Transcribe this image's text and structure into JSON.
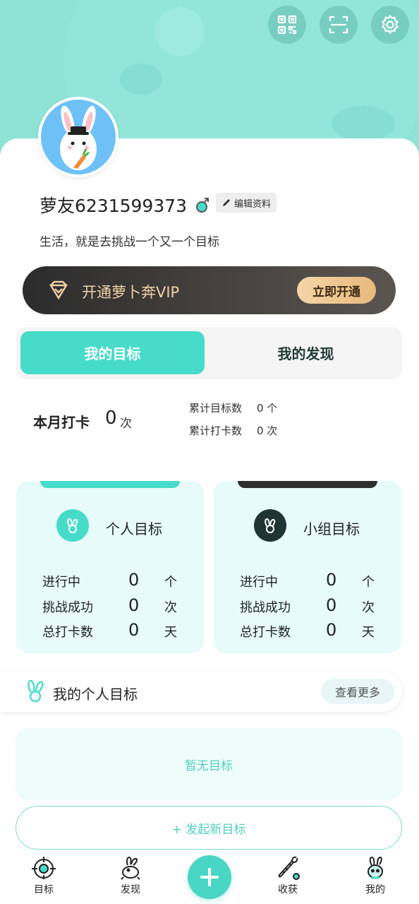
{
  "header": {
    "buttons": [
      "qr-code-icon",
      "scan-icon",
      "gear-icon"
    ],
    "bg_color": "#8fe3d6"
  },
  "profile": {
    "username": "萝友6231599373",
    "edit_label": "编辑资料",
    "bio": "生活，就是去挑战一个又一个目标"
  },
  "vip": {
    "text": "开通萝卜奔VIP",
    "button": "立即开通"
  },
  "tabs": [
    {
      "label": "我的目标",
      "active": true
    },
    {
      "label": "我的发现",
      "active": false
    }
  ],
  "monthly": {
    "label": "本月打卡",
    "count": "0",
    "unit": "次",
    "totals": [
      {
        "label": "累计目标数",
        "value": "0 个"
      },
      {
        "label": "累计打卡数",
        "value": "0 次"
      }
    ]
  },
  "goal_cards": [
    {
      "title": "个人目标",
      "accent": "#46dcc9",
      "rows": [
        {
          "label": "进行中",
          "value": "0",
          "unit": "个"
        },
        {
          "label": "挑战成功",
          "value": "0",
          "unit": "次"
        },
        {
          "label": "总打卡数",
          "value": "0",
          "unit": "天"
        }
      ]
    },
    {
      "title": "小组目标",
      "accent": "#1f3532",
      "rows": [
        {
          "label": "进行中",
          "value": "0",
          "unit": "个"
        },
        {
          "label": "挑战成功",
          "value": "0",
          "unit": "次"
        },
        {
          "label": "总打卡数",
          "value": "0",
          "unit": "天"
        }
      ]
    }
  ],
  "personal_goals": {
    "title": "我的个人目标",
    "more": "查看更多",
    "empty": "暂无目标",
    "new_goal": "+ 发起新目标"
  },
  "bottom_nav": [
    {
      "label": "目标",
      "icon": "target-icon"
    },
    {
      "label": "发现",
      "icon": "rabbit-run-icon"
    },
    {
      "label": "",
      "icon": "plus-icon"
    },
    {
      "label": "收获",
      "icon": "carrot-icon"
    },
    {
      "label": "我的",
      "icon": "rabbit-face-icon"
    }
  ]
}
